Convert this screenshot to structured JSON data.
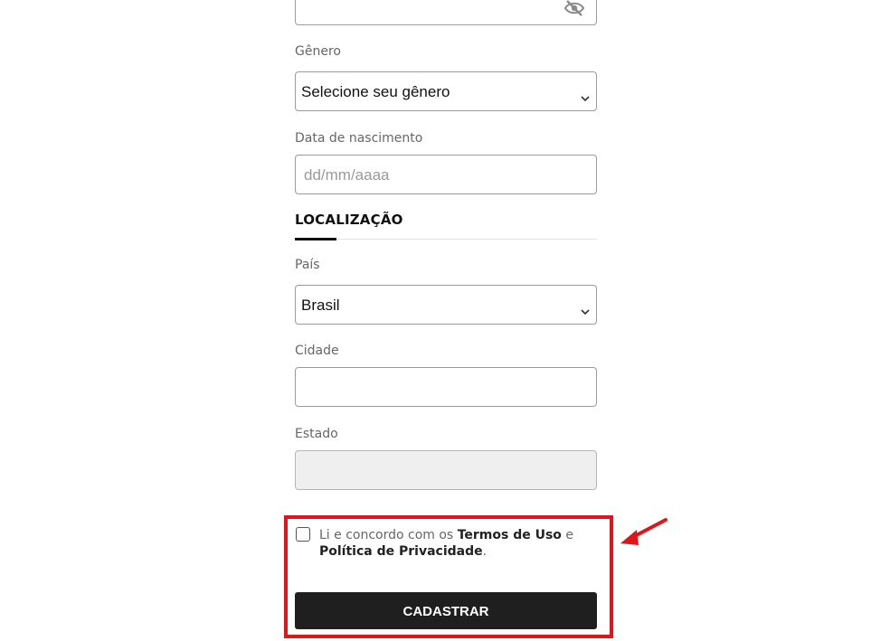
{
  "form": {
    "genero": {
      "label": "Gênero",
      "value": "Selecione seu gênero"
    },
    "nascimento": {
      "label": "Data de nascimento",
      "placeholder": "dd/mm/aaaa"
    },
    "section_title": "LOCALIZAÇÃO",
    "pais": {
      "label": "País",
      "value": "Brasil"
    },
    "cidade": {
      "label": "Cidade",
      "value": ""
    },
    "estado": {
      "label": "Estado",
      "value": ""
    },
    "terms": {
      "prefix": "Li e concordo com os ",
      "terms_link": "Termos de Uso",
      "mid": " e",
      "privacy_link": "Política de Privacidade",
      "suffix": "."
    },
    "submit_label": "CADASTRAR"
  },
  "icons": {
    "password_toggle": "eye-slash-icon",
    "select_chevron": "chevron-down-icon",
    "annotation_arrow": "arrow-icon"
  },
  "colors": {
    "highlight": "#e0151b",
    "button_bg": "#1f1f1f",
    "button_text": "#ffffff"
  }
}
